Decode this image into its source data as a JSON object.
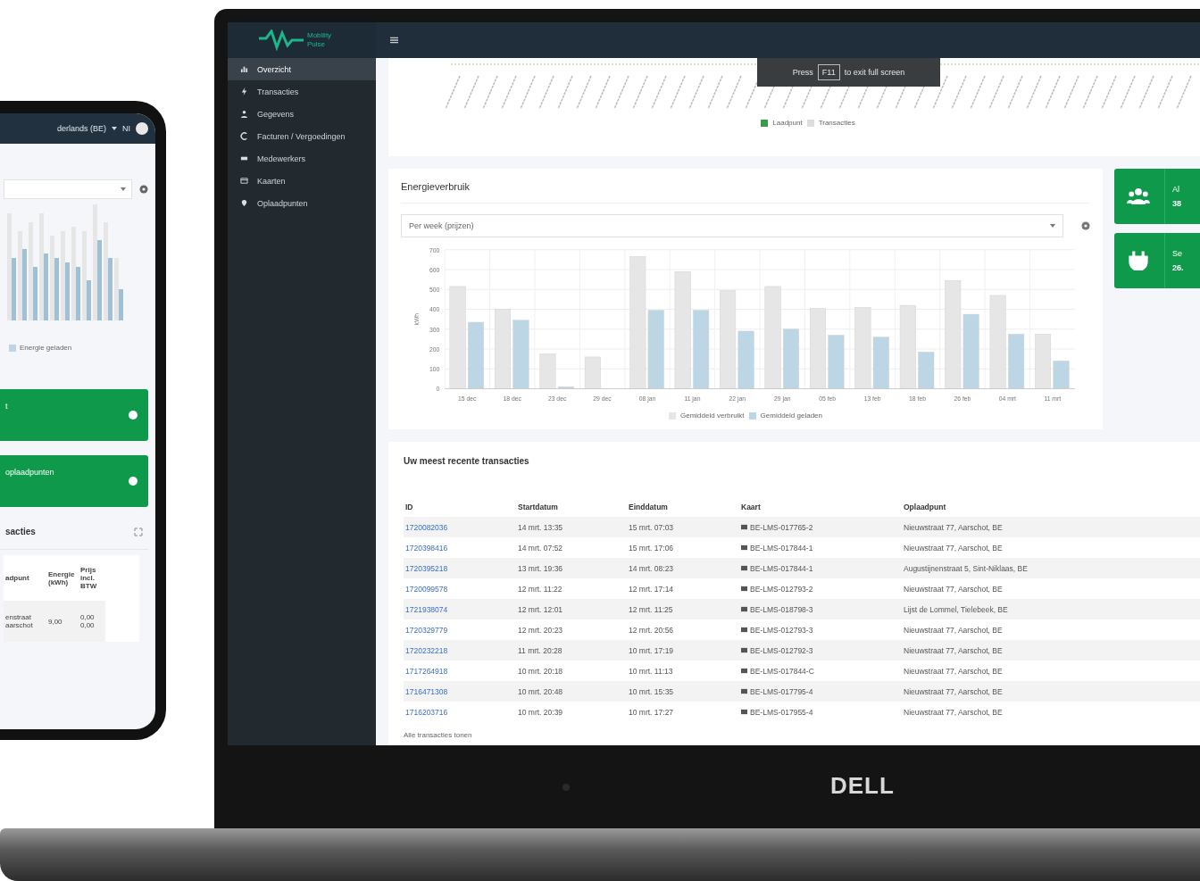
{
  "laptop": {
    "brand": "DELL",
    "logo": [
      "Mobility",
      "Pulse"
    ],
    "sidebar": {
      "items": [
        {
          "label": "Overzicht",
          "selected": true
        },
        {
          "label": "Transacties",
          "selected": false
        },
        {
          "label": "Gegevens",
          "selected": false
        },
        {
          "label": "Facturen / Vergoedingen",
          "selected": false
        },
        {
          "label": "Medewerkers",
          "selected": false
        },
        {
          "label": "Kaarten",
          "selected": false
        },
        {
          "label": "Oplaadpunten",
          "selected": false
        }
      ]
    },
    "toast": {
      "before": "Press",
      "key": "F11",
      "after": "to exit full screen"
    },
    "top_chart": {
      "legend": [
        {
          "label": "Laadpunt",
          "color": "#3e9a4a"
        },
        {
          "label": "Transacties",
          "color": "#dddddd"
        }
      ]
    },
    "energy": {
      "title": "Energieverbruik",
      "select": "Per week (prijzen)",
      "chart_data": {
        "type": "bar",
        "ylabel": "kWh",
        "categories": [
          "15 dec",
          "18 dec",
          "23 dec",
          "29 dec",
          "08 jan",
          "11 jan",
          "22 jan",
          "29 jan",
          "05 feb",
          "13 feb",
          "18 feb",
          "26 feb",
          "04 mrt",
          "11 mrt"
        ],
        "series": [
          {
            "name": "Gemiddeld verbruikt",
            "color": "#e6e6e6",
            "values": [
              515,
              400,
              175,
              160,
              665,
              590,
              495,
              515,
              405,
              410,
              420,
              545,
              470,
              275
            ]
          },
          {
            "name": "Gemiddeld geladen",
            "color": "#bcd6e6",
            "values": [
              335,
              345,
              10,
              null,
              395,
              395,
              290,
              300,
              270,
              260,
              185,
              375,
              275,
              140
            ]
          }
        ],
        "ylim": [
          0,
          700
        ],
        "yticks": [
          0,
          100,
          200,
          300,
          400,
          500,
          600,
          700
        ],
        "grid": true,
        "legend": true
      }
    },
    "stat_cards": [
      {
        "label": "Al",
        "value": "38"
      },
      {
        "label": "Se",
        "value": "26."
      }
    ],
    "transactions": {
      "title": "Uw meest recente transacties",
      "columns": [
        "ID",
        "Startdatum",
        "Einddatum",
        "Kaart",
        "Oplaadpunt"
      ],
      "rows": [
        [
          "1720082036",
          "14 mrt. 13:35",
          "15 mrt. 07:03",
          "BE-LMS-017765-2",
          "Nieuwstraat 77, Aarschot, BE"
        ],
        [
          "1720398416",
          "14 mrt. 07:52",
          "15 mrt. 17:06",
          "BE-LMS-017844-1",
          "Nieuwstraat 77, Aarschot, BE"
        ],
        [
          "1720395218",
          "13 mrt. 19:36",
          "14 mrt. 08:23",
          "BE-LMS-017844-1",
          "Augustijnenstraat 5, Sint-Niklaas, BE"
        ],
        [
          "1720099578",
          "12 mrt. 11:22",
          "12 mrt. 17:14",
          "BE-LMS-012793-2",
          "Nieuwstraat 77, Aarschot, BE"
        ],
        [
          "1721938074",
          "12 mrt. 12:01",
          "12 mrt. 11:25",
          "BE-LMS-018798-3",
          "Lijst de Lommel, Tielebeek, BE"
        ],
        [
          "1720329779",
          "12 mrt. 20:23",
          "12 mrt. 20:56",
          "BE-LMS-012793-3",
          "Nieuwstraat 77, Aarschot, BE"
        ],
        [
          "1720232218",
          "11 mrt. 20:28",
          "10 mrt. 17:19",
          "BE-LMS-012792-3",
          "Nieuwstraat 77, Aarschot, BE"
        ],
        [
          "1717264918",
          "10 mrt. 20:18",
          "10 mrt. 11:13",
          "BE-LMS-017844-C",
          "Nieuwstraat 77, Aarschot, BE"
        ],
        [
          "1716471308",
          "10 mrt. 20:48",
          "10 mrt. 15:35",
          "BE-LMS-017795-4",
          "Nieuwstraat 77, Aarschot, BE"
        ],
        [
          "1716203716",
          "10 mrt. 20:39",
          "10 mrt. 17:27",
          "BE-LMS-017955-4",
          "Nieuwstraat 77, Aarschot, BE"
        ]
      ],
      "link": "Alle transacties tonen"
    }
  },
  "phone": {
    "language": "derlands (BE)",
    "initials": "NI",
    "legend": {
      "label": "Energie geladen",
      "color": "#bcd6e6"
    },
    "cards": [
      {
        "label": "t"
      },
      {
        "label": "oplaadpunten"
      }
    ],
    "section_title": "sacties",
    "columns": [
      "adpunt",
      "Energie (kWh)",
      "Prijs incl. BTW"
    ],
    "row": {
      "address": [
        "enstraat",
        "aarschot"
      ],
      "energy": "9,00",
      "price": [
        "0,00",
        "0,00"
      ]
    }
  }
}
